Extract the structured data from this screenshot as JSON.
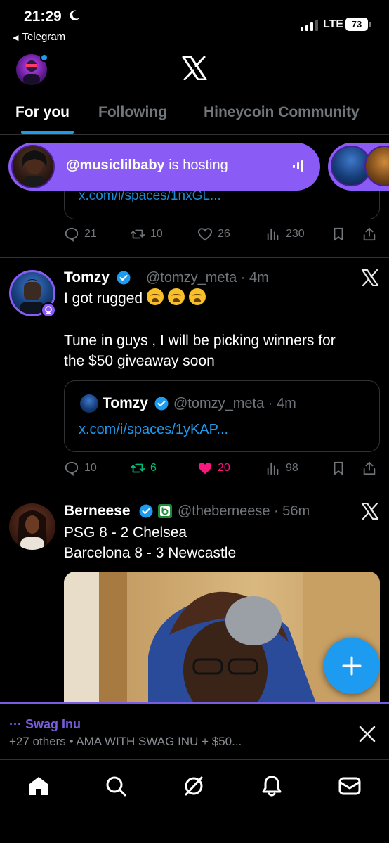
{
  "status_bar": {
    "time": "21:29",
    "back_app": "Telegram",
    "network": "LTE",
    "battery": "73"
  },
  "tabs": [
    {
      "label": "For you",
      "active": true
    },
    {
      "label": "Following",
      "active": false
    },
    {
      "label": "Hineycoin Community",
      "active": false
    }
  ],
  "spaces_bar": {
    "host_handle": "@musiclilbaby",
    "suffix": " is hosting"
  },
  "prev_tweet": {
    "link_partial": "x.com/i/spaces/1nxGL...",
    "replies": "21",
    "reposts": "10",
    "likes": "26",
    "views": "230"
  },
  "tweet1": {
    "name": "Tomzy",
    "handle_time": "@tomzy_meta · 4m",
    "line1": "I got rugged",
    "line2": "Tune in guys , I will be picking winners for",
    "line3": "the $50 giveaway soon",
    "quote": {
      "name": "Tomzy",
      "handle_time": "@tomzy_meta · 4m",
      "link": "x.com/i/spaces/1yKAP..."
    },
    "replies": "10",
    "reposts": "6",
    "likes": "20",
    "views": "98"
  },
  "tweet2": {
    "name": "Berneese",
    "handle_time": "@theberneese · 56m",
    "line1": "PSG 8 - 2 Chelsea",
    "line2": "Barcelona 8 - 3 Newcastle"
  },
  "mini_player": {
    "title": "··· Swag Inu",
    "subtitle": "+27 others • AMA WITH SWAG INU + $50..."
  },
  "colors": {
    "accent": "#1d9bf0",
    "spaces_purple": "#8a5cf5",
    "like_pink": "#f91880",
    "repost_green": "#00ba7c"
  }
}
